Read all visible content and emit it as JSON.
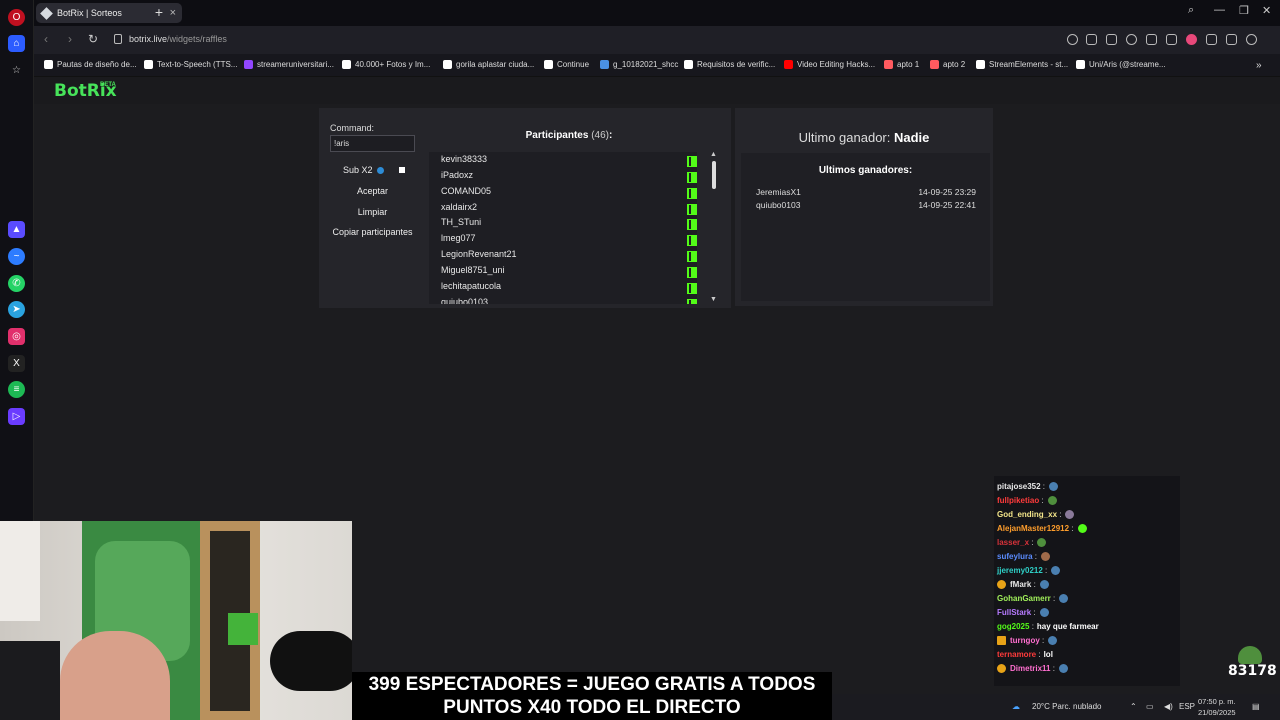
{
  "browser": {
    "tab_title": "BotRix | Sorteos",
    "url_host": "botrix.live",
    "url_path": "/widgets/raffles"
  },
  "bookmarks": [
    {
      "label": "Pautas de diseño de...",
      "color": "#ffffff"
    },
    {
      "label": "Text-to-Speech (TTS...",
      "color": "#ffffff"
    },
    {
      "label": "streameruniversitari...",
      "color": "#9146ff"
    },
    {
      "label": "40.000+ Fotos y Im...",
      "color": "#ffffff"
    },
    {
      "label": "gorila aplastar ciuda...",
      "color": "#ffffff"
    },
    {
      "label": "Continue",
      "color": "#ffffff"
    },
    {
      "label": "g_10182021_shcc",
      "color": "#4a90e2"
    },
    {
      "label": "Requisitos de verific...",
      "color": "#ffffff"
    },
    {
      "label": "Video Editing Hacks...",
      "color": "#ff0000"
    },
    {
      "label": "apto 1",
      "color": "#ff5a5f"
    },
    {
      "label": "apto 2",
      "color": "#ff5a5f"
    },
    {
      "label": "StreamElements - st...",
      "color": "#ffffff"
    },
    {
      "label": "Uni/Aris (@streame...",
      "color": "#ffffff"
    }
  ],
  "brand": {
    "logo": "BotRix",
    "badge": "BETA"
  },
  "raffle": {
    "command_label": "Command:",
    "command_value": "!aris",
    "sub_label": "Sub X2",
    "accept_label": "Aceptar",
    "clear_label": "Limpiar",
    "copy_label": "Copiar participantes",
    "participants_title": "Participantes",
    "participants_count": "(46)",
    "participants_colon": ":",
    "participants": [
      "kevin38333",
      "iPadoxz",
      "COMAND05",
      "xaldairx2",
      "TH_STuni",
      "lmeg077",
      "LegionRevenant21",
      "Miguel8751_uni",
      "lechitapatucola",
      "quiubo0103"
    ]
  },
  "winners": {
    "last_winner_label": "Ultimo ganador:",
    "last_winner_name": "Nadie",
    "recent_title": "Ultimos ganadores:",
    "recent": [
      {
        "name": "JeremiasX1",
        "date": "14-09-25 23:29"
      },
      {
        "name": "quiubo0103",
        "date": "14-09-25 22:41"
      }
    ]
  },
  "chat": [
    {
      "user": "pitajose352",
      "msg": "",
      "color": "#e8e8e8"
    },
    {
      "user": "fullpiketiao",
      "msg": "",
      "color": "#ff3b3b"
    },
    {
      "user": "God_ending_xx",
      "msg": "",
      "color": "#f3e58a"
    },
    {
      "user": "AlejanMaster12912",
      "msg": "",
      "color": "#ff9e2c"
    },
    {
      "user": "lasser_x",
      "msg": "",
      "color": "#d9323a"
    },
    {
      "user": "sufeylura",
      "msg": "",
      "color": "#5b8cff"
    },
    {
      "user": "jjeremy0212",
      "msg": "",
      "color": "#2fd1c8"
    },
    {
      "user": "fMark",
      "msg": "",
      "color": "#e8e8e8"
    },
    {
      "user": "GohanGamerr",
      "msg": "",
      "color": "#a0ef5a"
    },
    {
      "user": "FullStark",
      "msg": "",
      "color": "#b77bff"
    },
    {
      "user": "gog2025",
      "msg": "hay que farmear",
      "color": "#53fc18"
    },
    {
      "user": "turngoy",
      "msg": "",
      "color": "#ff6fd0"
    },
    {
      "user": "ternamore",
      "msg": "lol",
      "color": "#ff3b3b"
    },
    {
      "user": "Dimetrix11",
      "msg": "",
      "color": "#ff6fd0"
    }
  ],
  "overlay": {
    "banner_line1": "399 ESPECTADORES = JUEGO GRATIS A TODOS",
    "banner_line2": "PUNTOS X40 TODO EL DIRECTO",
    "counter": "83178"
  },
  "taskbar": {
    "weather": "20°C  Parc. nublado",
    "lang": "ESP",
    "time": "07:50 p. m.",
    "date": "21/09/2025"
  },
  "colors": {
    "kick_green": "#53fc18",
    "botrix_green": "#47e35a"
  }
}
